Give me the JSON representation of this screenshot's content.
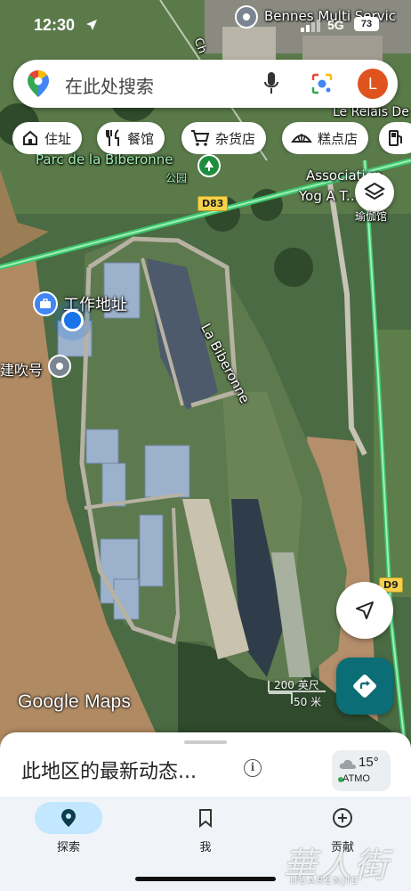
{
  "status_bar": {
    "time": "12:30",
    "network": "5G",
    "battery": "73"
  },
  "search": {
    "placeholder": "在此处搜索",
    "avatar_initial": "L"
  },
  "chips": [
    {
      "label": "住址",
      "icon": "home-icon"
    },
    {
      "label": "餐馆",
      "icon": "restaurant-icon"
    },
    {
      "label": "杂货店",
      "icon": "cart-icon"
    },
    {
      "label": "糕点店",
      "icon": "pastry-icon"
    },
    {
      "label": "",
      "icon": "gas-icon"
    }
  ],
  "map": {
    "labels": {
      "bennes": "Bennes Multi Servic",
      "relais": "Le Relais De",
      "parc": "Parc de la Biberonne",
      "parc_type": "公园",
      "association_1": "Association",
      "association_2": "Yog A T...",
      "yoga_type": "瑜伽馆",
      "work": "工作地址",
      "blow": "建吹号",
      "river": "La Biberonne",
      "road_d83": "D83",
      "road_d9": "D9",
      "street_ch": "Ch"
    },
    "scale_top": "200 英尺",
    "scale_bottom": "50 米",
    "attribution": "Google Maps",
    "layers_label": "瑜伽馆"
  },
  "sheet": {
    "title": "此地区的最新动态...",
    "weather_temp": "15°",
    "weather_aq": "ATMO"
  },
  "nav": {
    "items": [
      {
        "label": "探索",
        "icon": "explore-pin-icon",
        "active": true
      },
      {
        "label": "我",
        "icon": "bookmark-icon",
        "active": false
      },
      {
        "label": "贡献",
        "icon": "add-circle-icon",
        "active": false
      }
    ]
  },
  "watermark": {
    "zh": "華人街",
    "en": "HUARENJIE"
  },
  "colors": {
    "accent_blue": "#1a73e8",
    "directions_teal": "#0b6d75",
    "avatar_orange": "#e0531f",
    "road_green": "#3ec46d",
    "road_badge": "#f6d24a"
  }
}
